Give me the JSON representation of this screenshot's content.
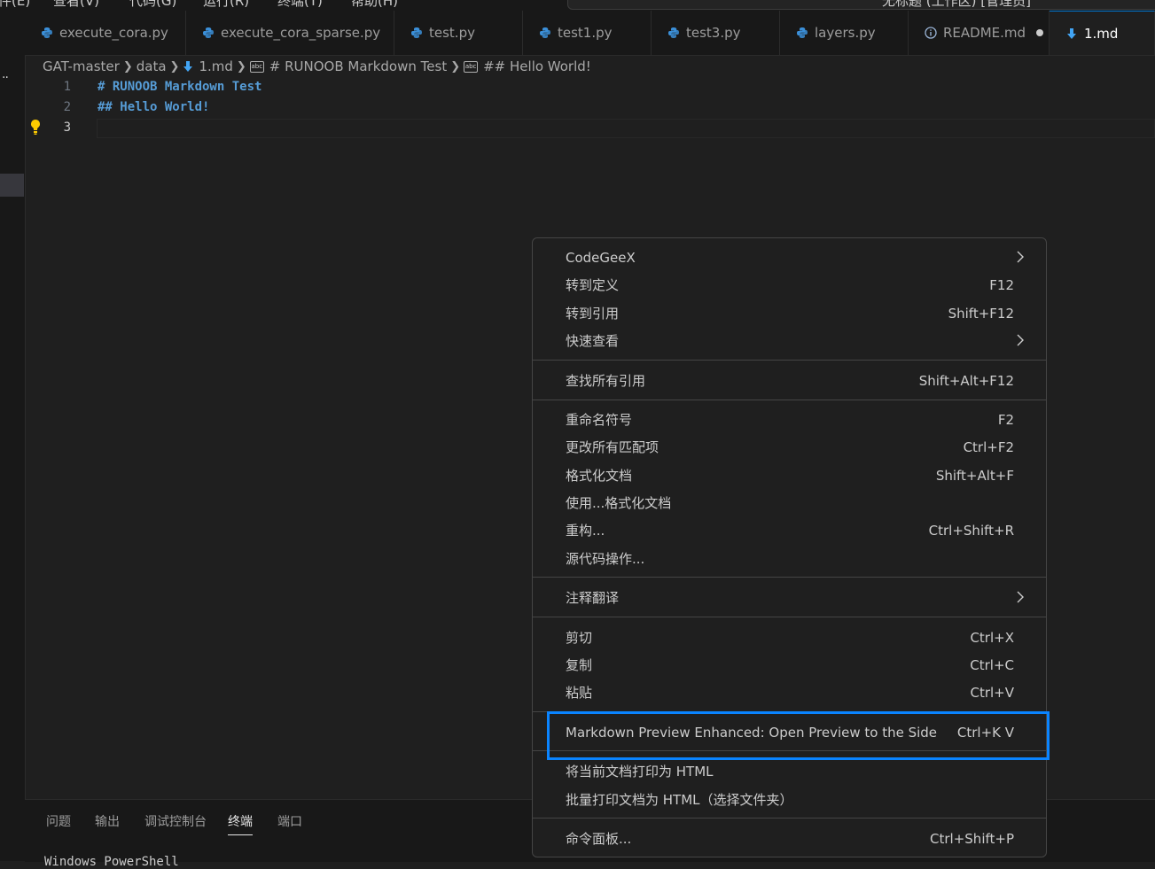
{
  "window": {
    "menu": [
      "件(E)",
      "查看(V)",
      "代码(G)",
      "运行(R)",
      "终端(T)",
      "帮助(H)"
    ],
    "command_center": "无标题 (工作区) [管理员]"
  },
  "tabs": [
    {
      "label": "execute_cora.py",
      "icon": "python-icon"
    },
    {
      "label": "execute_cora_sparse.py",
      "icon": "python-icon"
    },
    {
      "label": "test.py",
      "icon": "python-icon"
    },
    {
      "label": "test1.py",
      "icon": "python-icon"
    },
    {
      "label": "test3.py",
      "icon": "python-icon"
    },
    {
      "label": "layers.py",
      "icon": "python-icon"
    },
    {
      "label": "README.md",
      "icon": "info-icon",
      "modified": true
    },
    {
      "label": "1.md",
      "icon": "markdown-icon",
      "active": true
    }
  ],
  "breadcrumb": {
    "folder1": "GAT-master",
    "folder2": "data",
    "file": "1.md",
    "symbol1": "# RUNOOB Markdown Test",
    "symbol2": "## Hello World!"
  },
  "editor": {
    "lines": [
      {
        "num": "1",
        "text": "# RUNOOB Markdown Test"
      },
      {
        "num": "2",
        "text": "## Hello World!"
      },
      {
        "num": "3",
        "text": ""
      }
    ],
    "current_line": 3
  },
  "context_menu": {
    "items": [
      {
        "label": "CodeGeeX",
        "shortcut": "",
        "submenu": true
      },
      {
        "label": "转到定义",
        "shortcut": "F12"
      },
      {
        "label": "转到引用",
        "shortcut": "Shift+F12"
      },
      {
        "label": "快速查看",
        "shortcut": "",
        "submenu": true
      },
      {
        "label": "查找所有引用",
        "shortcut": "Shift+Alt+F12"
      },
      {
        "label": "重命名符号",
        "shortcut": "F2"
      },
      {
        "label": "更改所有匹配项",
        "shortcut": "Ctrl+F2"
      },
      {
        "label": "格式化文档",
        "shortcut": "Shift+Alt+F"
      },
      {
        "label": "使用...格式化文档",
        "shortcut": ""
      },
      {
        "label": "重构...",
        "shortcut": "Ctrl+Shift+R"
      },
      {
        "label": "源代码操作...",
        "shortcut": ""
      },
      {
        "label": "注释翻译",
        "shortcut": "",
        "submenu": true
      },
      {
        "label": "剪切",
        "shortcut": "Ctrl+X"
      },
      {
        "label": "复制",
        "shortcut": "Ctrl+C"
      },
      {
        "label": "粘贴",
        "shortcut": "Ctrl+V"
      },
      {
        "label": "Markdown Preview Enhanced: Open Preview to the Side",
        "shortcut": "Ctrl+K V",
        "highlighted": true
      },
      {
        "label": "将当前文档打印为 HTML",
        "shortcut": ""
      },
      {
        "label": "批量打印文档为 HTML（选择文件夹）",
        "shortcut": ""
      },
      {
        "label": "命令面板...",
        "shortcut": "Ctrl+Shift+P"
      }
    ]
  },
  "panel": {
    "tabs": [
      "问题",
      "输出",
      "调试控制台",
      "终端",
      "端口"
    ],
    "active_tab": "终端",
    "terminal_text": "Windows PowerShell"
  },
  "colors": {
    "accent": "#0078d4",
    "highlight_border": "#0a84ff",
    "markdown_heading": "#569cd6",
    "python_icon": "#3b8fd8",
    "markdown_icon": "#42a5f5",
    "lightbulb": "#ffcc00"
  }
}
